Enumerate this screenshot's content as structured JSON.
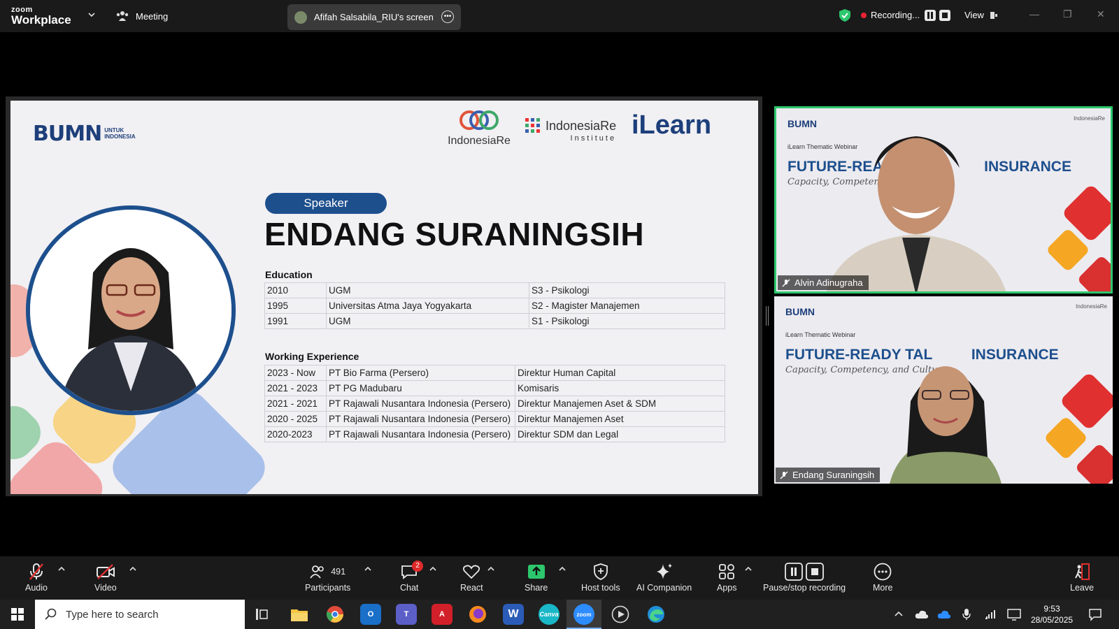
{
  "topbar": {
    "logo_small": "zoom",
    "logo_big": "Workplace",
    "meeting_label": "Meeting",
    "screen_share_label": "Afifah Salsabila_RIU's screen",
    "recording_label": "Recording...",
    "view_label": "View"
  },
  "slide": {
    "bumn_big": "BUMN",
    "bumn_small_1": "UNTUK",
    "bumn_small_2": "INDONESIA",
    "logo_indonesiare": "IndonesiaRe",
    "logo_iri_name": "IndonesiaRe",
    "logo_iri_sub": "Institute",
    "logo_ilearn": "iLearn",
    "speaker_tag": "Speaker",
    "speaker_name": "ENDANG SURANINGSIH",
    "education_title": "Education",
    "education": [
      {
        "year": "2010",
        "school": "UGM",
        "degree": "S3 - Psikologi"
      },
      {
        "year": "1995",
        "school": "Universitas Atma Jaya Yogyakarta",
        "degree": "S2 - Magister Manajemen"
      },
      {
        "year": "1991",
        "school": "UGM",
        "degree": "S1 - Psikologi"
      }
    ],
    "work_title": "Working Experience",
    "work": [
      {
        "period": "2023 - Now",
        "company": "PT Bio Farma (Persero)",
        "role": "Direktur Human Capital"
      },
      {
        "period": "2021 - 2023",
        "company": "PT PG Madubaru",
        "role": "Komisaris"
      },
      {
        "period": "2021 - 2021",
        "company": "PT Rajawali Nusantara Indonesia (Persero)",
        "role": "Direktur Manajemen Aset & SDM"
      },
      {
        "period": "2020 - 2025",
        "company": "PT Rajawali Nusantara Indonesia (Persero)",
        "role": "Direktur Manajemen Aset"
      },
      {
        "period": "2020-2023",
        "company": "PT Rajawali Nusantara Indonesia (Persero)",
        "role": "Direktur SDM dan Legal"
      }
    ]
  },
  "tiles": [
    {
      "bumn": "BUMN",
      "subtitle": "iLearn Thematic Webinar",
      "headline": "FUTURE-READY",
      "headline_end": "INSURANCE",
      "script": "Capacity, Competency, and Culture",
      "logo": "IndonesiaRe",
      "name": "Alvin Adinugraha"
    },
    {
      "bumn": "BUMN",
      "subtitle": "iLearn Thematic Webinar",
      "headline": "FUTURE-READY TAL",
      "headline_end": "INSURANCE",
      "script": "Capacity, Competency, and Culture",
      "logo": "IndonesiaRe",
      "name": "Endang Suraningsih"
    }
  ],
  "toolbar": {
    "audio": "Audio",
    "video": "Video",
    "participants": "Participants",
    "participants_count": "491",
    "chat": "Chat",
    "chat_badge": "2",
    "react": "React",
    "share": "Share",
    "host_tools": "Host tools",
    "ai_companion": "AI Companion",
    "apps": "Apps",
    "pause_recording": "Pause/stop recording",
    "more": "More",
    "leave": "Leave"
  },
  "taskbar": {
    "search_placeholder": "Type here to search",
    "canva": "Canva",
    "zoom": "zoom",
    "word": "W",
    "time": "9:53",
    "date": "28/05/2025"
  },
  "colors": {
    "accent_green": "#2dc76d",
    "brand_blue": "#1d4f8d",
    "recording_red": "#e23333"
  }
}
